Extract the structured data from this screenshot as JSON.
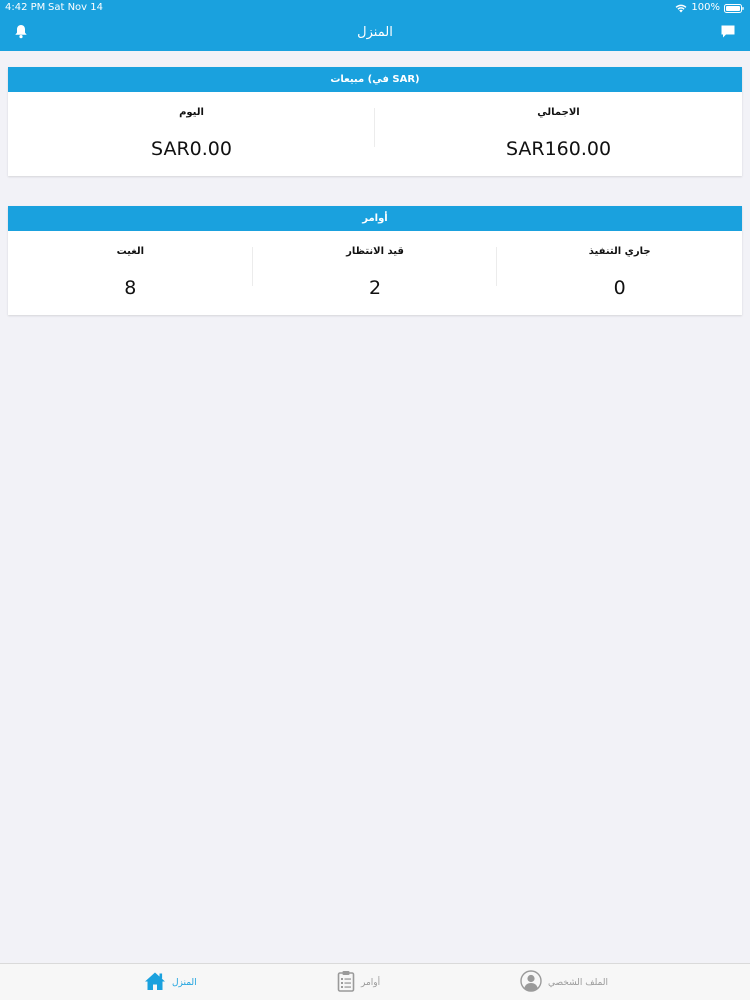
{
  "status_bar": {
    "time": "4:42 PM",
    "date": "Sat Nov 14",
    "battery": "100%"
  },
  "nav": {
    "title": "المنزل",
    "left_icon": "bell-icon",
    "right_icon": "chat-icon"
  },
  "sales": {
    "title": "مبيعات (في SAR)",
    "total_label": "الاجمالي",
    "total_value": "SAR160.00",
    "today_label": "اليوم",
    "today_value": "SAR0.00"
  },
  "orders": {
    "title": "أوامر",
    "in_progress_label": "جاري التنفيذ",
    "in_progress_value": "0",
    "pending_label": "قيد الانتظار",
    "pending_value": "2",
    "cancelled_label": "الغيت",
    "cancelled_value": "8"
  },
  "tabs": {
    "home": {
      "label": "المنزل",
      "icon": "home-icon"
    },
    "orders": {
      "label": "أوامر",
      "icon": "clipboard-icon"
    },
    "profile": {
      "label": "الملف الشخصي",
      "icon": "profile-icon"
    }
  },
  "colors": {
    "accent": "#1aa1de",
    "background": "#f2f2f7",
    "inactive_tab": "#9a9a9a"
  }
}
